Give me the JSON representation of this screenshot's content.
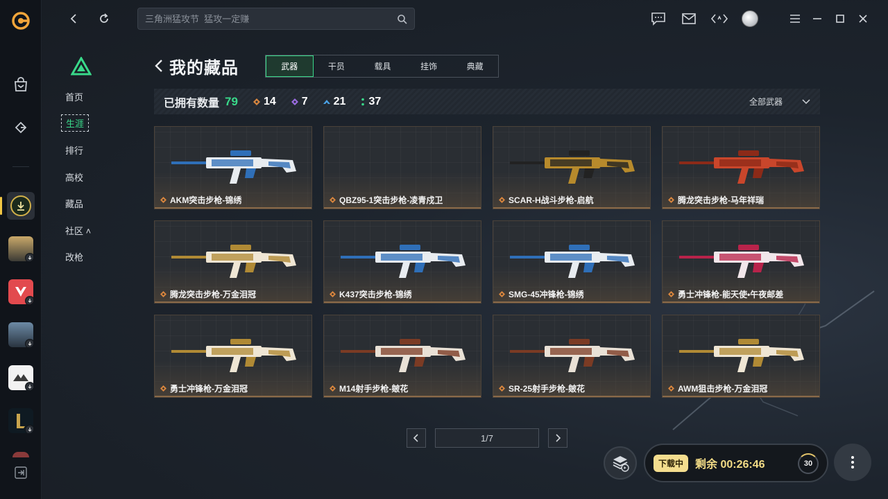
{
  "search": {
    "placeholder": "三角洲猛攻节  猛攻一定赚"
  },
  "sidenav": {
    "items": [
      {
        "label": "首页"
      },
      {
        "label": "生涯"
      },
      {
        "label": "排行"
      },
      {
        "label": "高校"
      },
      {
        "label": "藏品"
      },
      {
        "label": "社区 ˄"
      },
      {
        "label": "改枪"
      }
    ]
  },
  "page": {
    "title": "我的藏品"
  },
  "tabs": [
    {
      "label": "武器"
    },
    {
      "label": "干员"
    },
    {
      "label": "载具"
    },
    {
      "label": "挂饰"
    },
    {
      "label": "典藏"
    }
  ],
  "stats": {
    "owned_label": "已拥有数量",
    "owned_count": "79",
    "chips": [
      {
        "value": "14",
        "color": "#d9863e"
      },
      {
        "value": "7",
        "color": "#9a6be0"
      },
      {
        "value": "21",
        "color": "#4aa3e8"
      },
      {
        "value": "37",
        "color": "#39d98a"
      }
    ],
    "filter_label": "全部武器"
  },
  "items": [
    {
      "name": "AKM突击步枪-锦绣",
      "gun_color": "#2f6fb8",
      "accent": "#e8ecf0"
    },
    {
      "name": "QBZ95-1突击步枪-凌青戍卫",
      "gun_color": "",
      "accent": ""
    },
    {
      "name": "SCAR-H战斗步枪-启航",
      "gun_color": "#222222",
      "accent": "#b78a2c"
    },
    {
      "name": "腾龙突击步枪-马年祥瑞",
      "gun_color": "#8c2a18",
      "accent": "#c9462b"
    },
    {
      "name": "腾龙突击步枪-万金泪冠",
      "gun_color": "#b08a35",
      "accent": "#efe6d4"
    },
    {
      "name": "K437突击步枪-锦绣",
      "gun_color": "#2f6fb8",
      "accent": "#e8ecf0"
    },
    {
      "name": "SMG-45冲锋枪-锦绣",
      "gun_color": "#2f6fb8",
      "accent": "#e8ecf0"
    },
    {
      "name": "勇士冲锋枪-能天使•午夜邮差",
      "gun_color": "#b8234a",
      "accent": "#f1e6ea"
    },
    {
      "name": "勇士冲锋枪-万金泪冠",
      "gun_color": "#b08a35",
      "accent": "#efe6d4"
    },
    {
      "name": "M14射手步枪-皴花",
      "gun_color": "#7b3b24",
      "accent": "#e9e1d6"
    },
    {
      "name": "SR-25射手步枪-皴花",
      "gun_color": "#7b3b24",
      "accent": "#e9e1d6"
    },
    {
      "name": "AWM狙击步枪-万金泪冠",
      "gun_color": "#b08a35",
      "accent": "#efe6d4"
    }
  ],
  "pagination": {
    "label": "1/7"
  },
  "download": {
    "status": "下载中",
    "remaining": "剩余 00:26:46",
    "ring": "30"
  },
  "colors": {
    "accent": "#39d98a",
    "rarity": "#d9863e"
  }
}
